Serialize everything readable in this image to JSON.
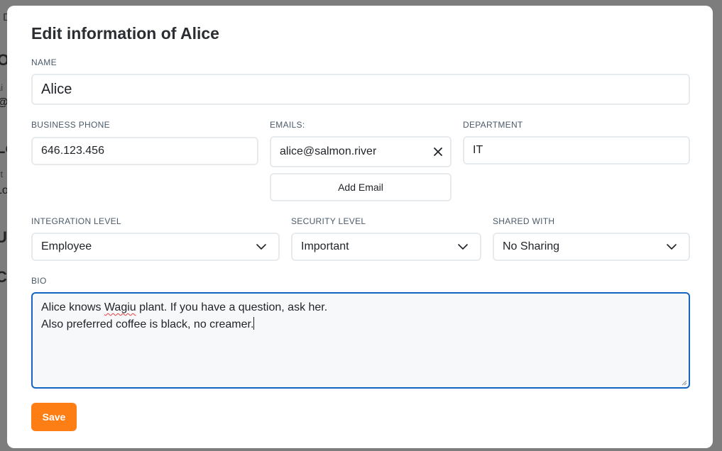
{
  "background": {
    "fragments": [
      "D",
      "Ov",
      "ai",
      "@",
      "Lo",
      "st",
      "Lo",
      "Us",
      "C"
    ]
  },
  "modal": {
    "title": "Edit information of Alice",
    "name": {
      "label": "NAME",
      "value": "Alice"
    },
    "business_phone": {
      "label": "BUSINESS PHONE",
      "value": "646.123.456"
    },
    "emails": {
      "label": "EMAILS:",
      "items": [
        "alice@salmon.river"
      ],
      "add_label": "Add Email",
      "remove_icon": "close-icon"
    },
    "department": {
      "label": "DEPARTMENT",
      "value": "IT"
    },
    "integration_level": {
      "label": "INTEGRATION LEVEL",
      "selected": "Employee"
    },
    "security_level": {
      "label": "SECURITY LEVEL",
      "selected": "Important"
    },
    "shared_with": {
      "label": "SHARED WITH",
      "selected": "No Sharing"
    },
    "bio": {
      "label": "BIO",
      "line1_before": "Alice knows ",
      "line1_misspelled": "Wagiu",
      "line1_after": " plant. If you have a question, ask her.",
      "line2": "Also preferred coffee is black, no creamer."
    },
    "save_label": "Save"
  },
  "colors": {
    "accent": "#fd7e14",
    "focus_border": "#1565c0",
    "overlay": "#7d7d7d"
  }
}
